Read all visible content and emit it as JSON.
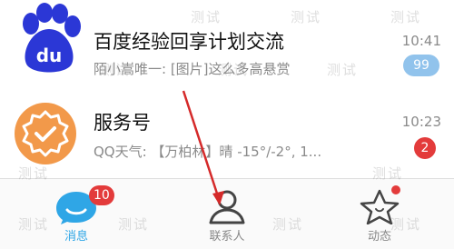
{
  "conversations": [
    {
      "title": "百度经验回享计划交流",
      "preview": "陌小嵩唯一: [图片]这么多高悬赏",
      "time": "10:41",
      "badge": "99",
      "avatar_icon": "baidu-paw-icon",
      "avatar_text": "du",
      "badge_color": "#91c3ec"
    },
    {
      "title": "服务号",
      "preview": "QQ天气: 【万柏林】晴 -15°/-2°, 1...",
      "time": "10:23",
      "badge": "2",
      "avatar_icon": "service-badge-icon",
      "badge_color": "#e33b3b"
    }
  ],
  "tabbar": {
    "tabs": [
      {
        "label": "消息",
        "icon": "chat-bubble-icon",
        "badge": "10",
        "active": true
      },
      {
        "label": "联系人",
        "icon": "contacts-person-icon",
        "active": false
      },
      {
        "label": "动态",
        "icon": "star-icon",
        "dot": true,
        "active": false
      }
    ]
  },
  "watermark": "测试",
  "colors": {
    "accent": "#2fa6e6",
    "badge_red": "#e33b3b",
    "baidu_blue": "#2b37d6",
    "service_orange": "#f2994a"
  }
}
